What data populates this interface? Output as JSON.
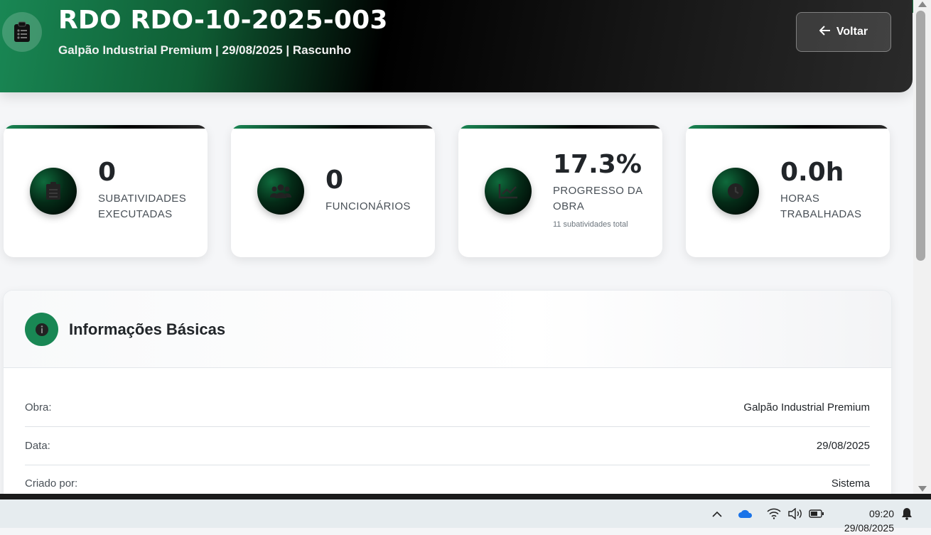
{
  "header": {
    "title": "RDO RDO-10-2025-003",
    "subtitle": "Galpão Industrial Premium | 29/08/2025 | Rascunho",
    "back_label": "Voltar"
  },
  "stats": [
    {
      "value": "0",
      "label": "SUBATIVIDADES EXECUTADAS",
      "icon": "clipboard-list-icon"
    },
    {
      "value": "0",
      "label": "FUNCIONÁRIOS",
      "icon": "users-icon"
    },
    {
      "value": "17.3%",
      "label": "PROGRESSO DA OBRA",
      "note": "11 subatividades total",
      "icon": "chart-line-icon"
    },
    {
      "value": "0.0h",
      "label": "HORAS TRABALHADAS",
      "icon": "clock-icon"
    }
  ],
  "info": {
    "title": "Informações Básicas",
    "rows": [
      {
        "key": "Obra:",
        "value": "Galpão Industrial Premium"
      },
      {
        "key": "Data:",
        "value": "29/08/2025"
      },
      {
        "key": "Criado por:",
        "value": "Sistema"
      }
    ]
  },
  "taskbar": {
    "time": "09:20",
    "date": "29/08/2025"
  },
  "colors": {
    "accent": "#198754",
    "header_dark": "#000000"
  }
}
